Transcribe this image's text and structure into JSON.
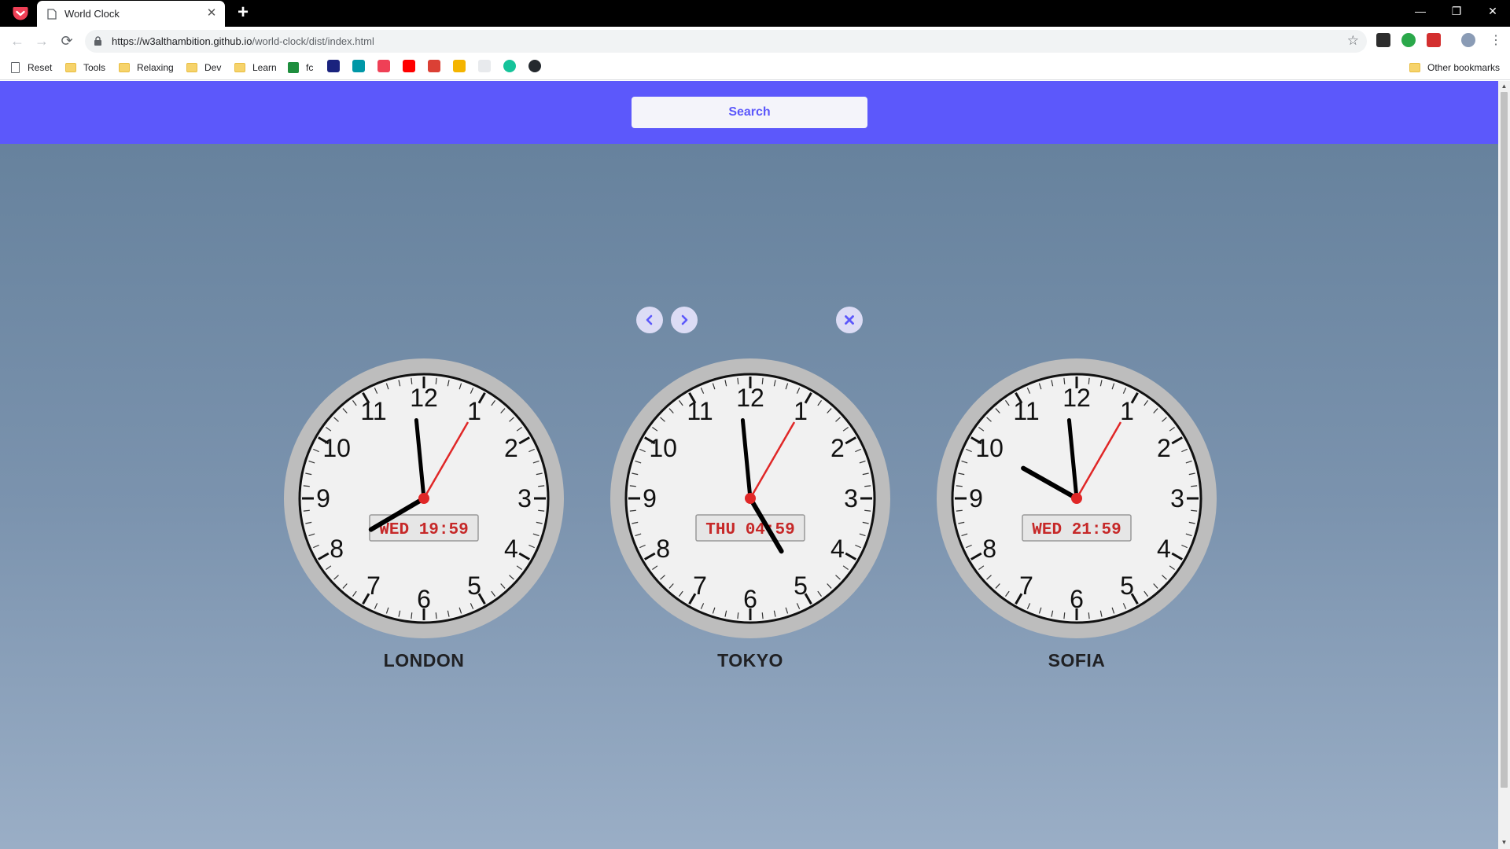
{
  "browser": {
    "tab_title": "World Clock",
    "url_host": "https://w3althambition.github.io",
    "url_path": "/world-clock/dist/index.html",
    "bookmarks": [
      "Reset",
      "Tools",
      "Relaxing",
      "Dev",
      "Learn",
      "fc"
    ],
    "other_bookmarks": "Other bookmarks",
    "icons": {
      "back": "arrow-left-icon",
      "forward": "arrow-right-icon",
      "reload": "reload-icon",
      "star": "star-icon"
    }
  },
  "app": {
    "accent_color": "#5c58fb",
    "search": {
      "placeholder": "Search"
    },
    "controls": {
      "prev": "chevron-left-icon",
      "next": "chevron-right-icon",
      "close": "close-icon"
    },
    "clocks": [
      {
        "city": "LONDON",
        "display": "WED 19:59",
        "hour": 19,
        "minute": 59,
        "second": 5
      },
      {
        "city": "TOKYO",
        "display": "THU 04:59",
        "hour": 4,
        "minute": 59,
        "second": 5
      },
      {
        "city": "SOFIA",
        "display": "WED 21:59",
        "hour": 21,
        "minute": 59,
        "second": 5
      }
    ]
  }
}
